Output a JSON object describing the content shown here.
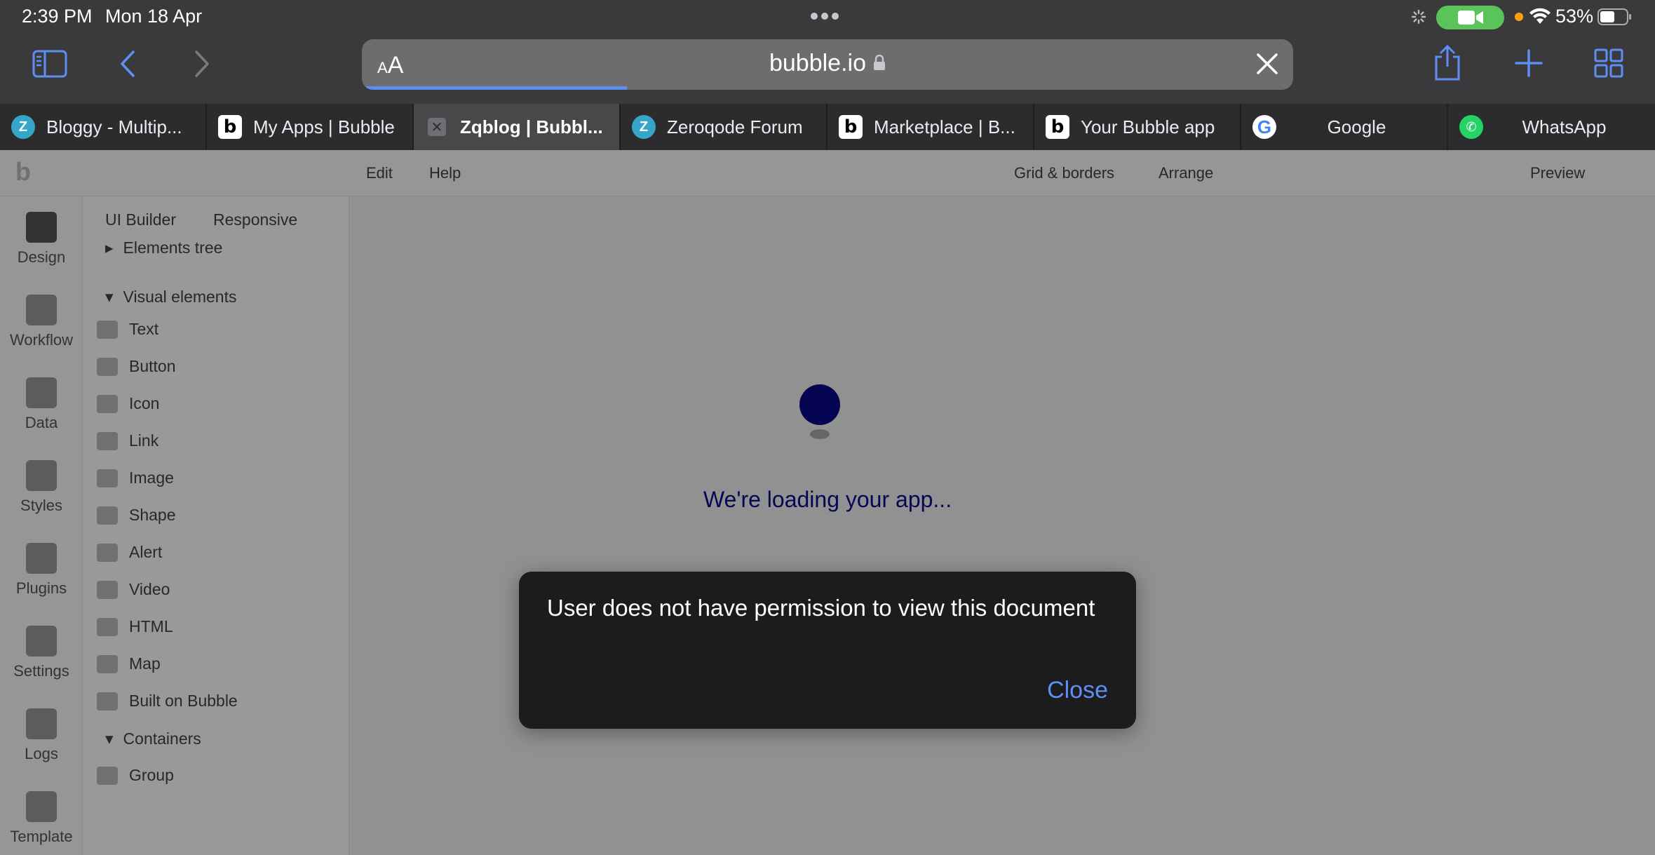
{
  "status_bar": {
    "time": "2:39 PM",
    "date": "Mon 18 Apr",
    "battery": "53%"
  },
  "toolbar": {
    "text_size_label": "AA",
    "url": "bubble.io"
  },
  "tabs": [
    {
      "title": "Bloggy - Multip...",
      "favicon": "zeroqode-icon"
    },
    {
      "title": "My Apps | Bubble",
      "favicon": "bubble-icon"
    },
    {
      "title": "Zqblog | Bubbl...",
      "favicon": "close-tab-icon",
      "active": true
    },
    {
      "title": "Zeroqode Forum",
      "favicon": "zeroqode-icon"
    },
    {
      "title": "Marketplace | B...",
      "favicon": "bubble-icon"
    },
    {
      "title": "Your Bubble app",
      "favicon": "bubble-icon"
    },
    {
      "title": "Google",
      "favicon": "google-icon"
    },
    {
      "title": "WhatsApp",
      "favicon": "whatsapp-icon"
    }
  ],
  "editor": {
    "menu": {
      "edit": "Edit",
      "help": "Help",
      "grid": "Grid & borders",
      "arrange": "Arrange",
      "preview": "Preview"
    },
    "rail": [
      "Design",
      "Workflow",
      "Data",
      "Styles",
      "Plugins",
      "Settings",
      "Logs",
      "Template"
    ],
    "panel": {
      "ui_builder": "UI Builder",
      "responsive": "Responsive",
      "elements_tree": "Elements tree",
      "visual_elements": "Visual elements",
      "items": [
        "Text",
        "Button",
        "Icon",
        "Link",
        "Image",
        "Shape",
        "Alert",
        "Video",
        "HTML",
        "Map",
        "Built on Bubble"
      ],
      "containers": "Containers",
      "group": "Group"
    },
    "loading_text": "We're loading your app..."
  },
  "alert": {
    "message": "User does not have permission to view this document",
    "close_label": "Close"
  },
  "colors": {
    "accent": "#5e8ff2",
    "loader": "#07078a",
    "facetime": "#5ac45a"
  }
}
